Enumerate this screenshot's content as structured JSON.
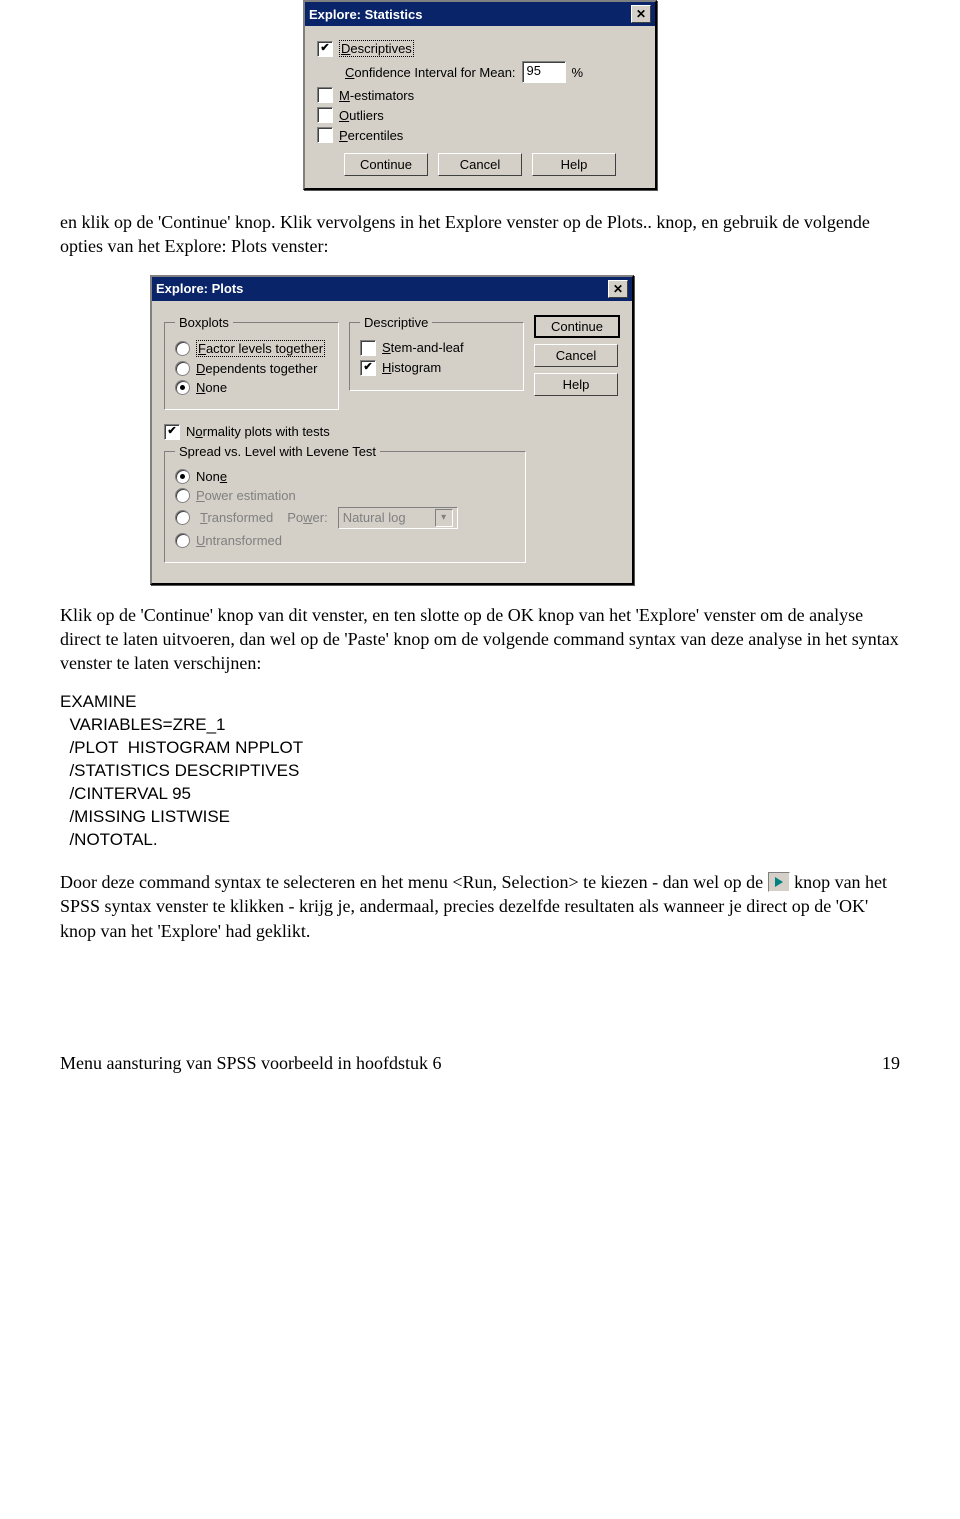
{
  "dlg_stats": {
    "title": "Explore: Statistics",
    "close": "✕",
    "descriptives": "Descriptives",
    "ci_label_pre": "Confidence Interval for Mean:",
    "ci_value": "95",
    "ci_pct": "%",
    "mestimators": "M-estimators",
    "outliers": "Outliers",
    "percentiles": "Percentiles",
    "continue": "Continue",
    "cancel": "Cancel",
    "help": "Help"
  },
  "para1": "en klik op de 'Continue' knop. Klik vervolgens in het Explore venster op de Plots.. knop, en gebruik de volgende opties van het Explore: Plots venster:",
  "dlg_plots": {
    "title": "Explore: Plots",
    "close": "✕",
    "boxplots_legend": "Boxplots",
    "factor": "Factor levels together",
    "dependents": "Dependents together",
    "none_box": "None",
    "descriptive_legend": "Descriptive",
    "stem": "Stem-and-leaf",
    "histogram": "Histogram",
    "continue": "Continue",
    "cancel": "Cancel",
    "help": "Help",
    "normality": "Normality plots with tests",
    "spread_legend": "Spread vs. Level with Levene Test",
    "sp_none": "None",
    "sp_power": "Power estimation",
    "sp_trans": "Transformed",
    "sp_power_label": "Power:",
    "sp_power_value": "Natural log",
    "sp_untrans": "Untransformed"
  },
  "para2": "Klik op de 'Continue' knop van dit venster, en ten slotte op de OK knop van het 'Explore' venster om de analyse direct te laten uitvoeren, dan wel op de 'Paste' knop om de volgende command syntax van deze analyse in het syntax venster te laten verschijnen:",
  "syntax": "EXAMINE\n  VARIABLES=ZRE_1\n  /PLOT  HISTOGRAM NPPLOT\n  /STATISTICS DESCRIPTIVES\n  /CINTERVAL 95\n  /MISSING LISTWISE\n  /NOTOTAL.",
  "para3_a": "Door deze command syntax te selecteren en het menu <Run, Selection> te kiezen - dan wel op de ",
  "para3_b": " knop van het SPSS syntax venster te klikken - krijg je, andermaal, precies dezelfde resultaten als wanneer je direct op de 'OK' knop van het 'Explore' had geklikt.",
  "footer_text": "Menu aansturing van SPSS voorbeeld in hoofdstuk 6",
  "footer_page": "19"
}
